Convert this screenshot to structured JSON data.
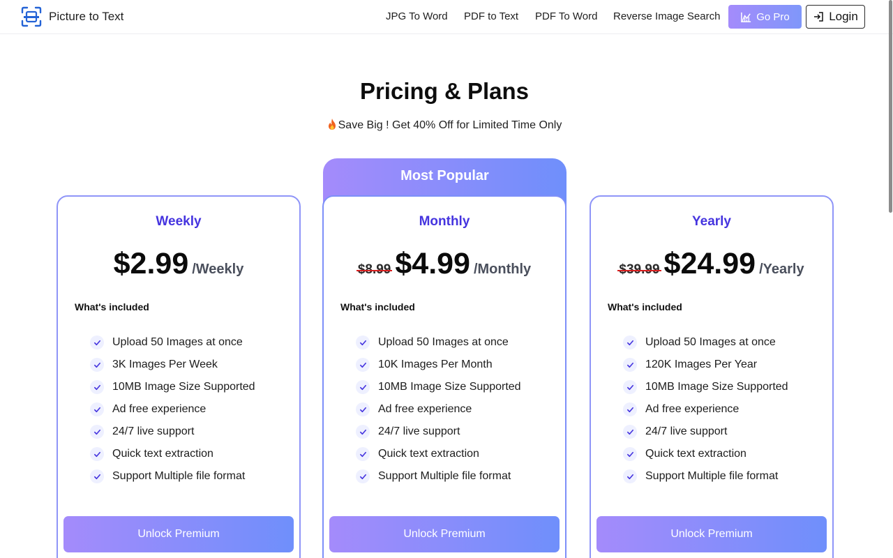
{
  "header": {
    "brand_name": "Picture to Text",
    "logo_icon": "scan-frame-icon",
    "nav": [
      "JPG To Word",
      "PDF to Text",
      "PDF To Word",
      "Reverse Image Search"
    ],
    "go_pro_label": "Go Pro",
    "go_pro_icon": "crown-chart-icon",
    "login_label": "Login",
    "login_icon": "login-arrow-icon"
  },
  "hero": {
    "title": "Pricing & Plans",
    "subtitle": "Save Big ! Get 40% Off for Limited Time Only",
    "subtitle_icon": "fire-icon"
  },
  "popular_label": "Most Popular",
  "plans": [
    {
      "name": "Weekly",
      "old_price": "",
      "price": "$2.99",
      "period": "/Weekly",
      "included_label": "What's included",
      "features": [
        "Upload 50 Images at once",
        "3K Images Per Week",
        "10MB Image Size Supported",
        "Ad free experience",
        "24/7 live support",
        "Quick text extraction",
        "Support Multiple file format"
      ],
      "cta": "Unlock Premium"
    },
    {
      "name": "Monthly",
      "old_price": "$8.99",
      "price": "$4.99",
      "period": "/Monthly",
      "included_label": "What's included",
      "features": [
        "Upload 50 Images at once",
        "10K Images Per Month",
        "10MB Image Size Supported",
        "Ad free experience",
        "24/7 live support",
        "Quick text extraction",
        "Support Multiple file format"
      ],
      "cta": "Unlock Premium"
    },
    {
      "name": "Yearly",
      "old_price": "$39.99",
      "price": "$24.99",
      "period": "/Yearly",
      "included_label": "What's included",
      "features": [
        "Upload 50 Images at once",
        "120K Images Per Year",
        "10MB Image Size Supported",
        "Ad free experience",
        "24/7 live support",
        "Quick text extraction",
        "Support Multiple file format"
      ],
      "cta": "Unlock Premium"
    }
  ],
  "colors": {
    "accent_purple": "#4534df",
    "gradient_start": "#a48bfb",
    "gradient_end": "#6f8ffb",
    "card_border": "#8f95f8",
    "strike_red": "#d71e1e"
  }
}
